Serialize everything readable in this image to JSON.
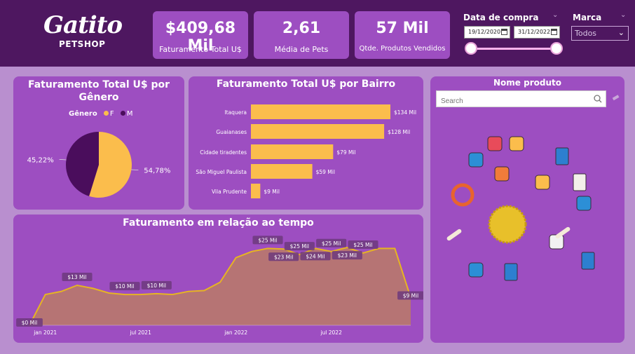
{
  "logo": {
    "main": "Gatito",
    "sub": "PETSHOP"
  },
  "kpis": [
    {
      "value": "$409,68 Mil",
      "label": "Faturamento Total U$"
    },
    {
      "value": "2,61",
      "label": "Média de Pets"
    },
    {
      "value": "57 Mil",
      "label": "Qtde. Produtos Vendidos"
    }
  ],
  "filters": {
    "date": {
      "label": "Data de compra",
      "start": "19/12/2020",
      "end": "31/12/2022"
    },
    "brand": {
      "label": "Marca",
      "value": "Todos"
    }
  },
  "product_panel": {
    "title": "Nome produto",
    "search_placeholder": "Search",
    "icons": [
      "dog-shirt-icon",
      "dog-shirt-icon",
      "cat-toy-icon",
      "dog-food-bag-icon",
      "dog-food-bag-icon",
      "dog-leash-icon",
      "dog-collar-icon",
      "pet-tag-icon",
      "dog-bowl-icon",
      "cat-bowl-icon",
      "bone-icon",
      "bone-icon",
      "spiky-ball-icon",
      "cat-food-can-icon",
      "dog-treats-icon",
      "cat-food-icon"
    ]
  },
  "colors": {
    "topbar": "#4e1760",
    "card": "#9d4ec1",
    "bg": "#b98fcf",
    "female": "#fbbd4c",
    "male": "#4a0d5c",
    "bar": "#fbbd4c",
    "line": "#e6b423",
    "area": "#b67474"
  },
  "chart_data": [
    {
      "type": "pie",
      "title": "Faturamento Total U$ por Gênero",
      "legend_title": "Gênero",
      "categories": [
        "F",
        "M"
      ],
      "values": [
        54.78,
        45.22
      ],
      "labels": [
        "54,78%",
        "45,22%"
      ]
    },
    {
      "type": "bar",
      "orientation": "horizontal",
      "title": "Faturamento Total U$ por Bairro",
      "categories": [
        "Itaquera",
        "Guaianases",
        "Cidade tiradentes",
        "São Miguel Paulista",
        "Vila Prudente"
      ],
      "values": [
        134,
        128,
        79,
        59,
        9
      ],
      "labels": [
        "$134 Mil",
        "$128 Mil",
        "$79 Mil",
        "$59 Mil",
        "$9 Mil"
      ]
    },
    {
      "type": "area",
      "title": "Faturamento em relação ao tempo",
      "x": [
        "2020-12",
        "2021-01",
        "2021-02",
        "2021-03",
        "2021-04",
        "2021-05",
        "2021-06",
        "2021-07",
        "2021-08",
        "2021-09",
        "2021-10",
        "2021-11",
        "2021-12",
        "2022-01",
        "2022-02",
        "2022-03",
        "2022-04",
        "2022-05",
        "2022-06",
        "2022-07",
        "2022-08",
        "2022-09",
        "2022-10",
        "2022-11",
        "2022-12"
      ],
      "y": [
        0,
        10,
        11,
        13,
        12,
        10.5,
        10,
        10,
        10.3,
        10,
        11,
        11.3,
        14,
        22,
        24,
        25,
        24.8,
        23,
        25,
        24,
        25.3,
        23.5,
        25,
        25,
        9
      ],
      "data_labels": [
        {
          "i": 0,
          "text": "$0 Mil"
        },
        {
          "i": 3,
          "text": "$13 Mil"
        },
        {
          "i": 6,
          "text": "$10 Mil"
        },
        {
          "i": 8,
          "text": "$10 Mil"
        },
        {
          "i": 15,
          "text": "$25 Mil"
        },
        {
          "i": 16,
          "text": "$23 Mil"
        },
        {
          "i": 17,
          "text": "$25 Mil"
        },
        {
          "i": 18,
          "text": "$24 Mil"
        },
        {
          "i": 19,
          "text": "$25 Mil"
        },
        {
          "i": 20,
          "text": "$23 Mil"
        },
        {
          "i": 21,
          "text": "$25 Mil"
        },
        {
          "i": 24,
          "text": "$9 Mil"
        }
      ],
      "x_ticks": [
        {
          "i": 1,
          "label": "jan 2021"
        },
        {
          "i": 7,
          "label": "jul 2021"
        },
        {
          "i": 13,
          "label": "jan 2022"
        },
        {
          "i": 19,
          "label": "jul 2022"
        }
      ]
    }
  ]
}
